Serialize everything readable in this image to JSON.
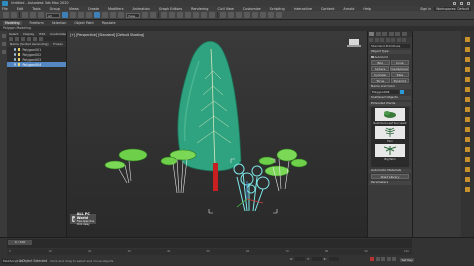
{
  "window": {
    "title": "Untitled - Autodesk 3ds Max 2020"
  },
  "menu": {
    "items": [
      "File",
      "Edit",
      "Tools",
      "Group",
      "Views",
      "Create",
      "Modifiers",
      "Animation",
      "Graph Editors",
      "Rendering",
      "Civil View",
      "Customize",
      "Scripting",
      "Interactive",
      "Content",
      "Arnold",
      "Help"
    ],
    "user": "Sign In",
    "workspace": "Workspaces: Default"
  },
  "toolbar": {
    "selection_filter": "All",
    "view_dropdown": "View"
  },
  "ribbon": {
    "tabs": [
      "Modeling",
      "Freeform",
      "Selection",
      "Object Paint",
      "Populate"
    ],
    "sub_label": "Polygon Modeling"
  },
  "explorer": {
    "tabs": [
      "Select",
      "Display",
      "Edit",
      "Customize"
    ],
    "column_header": "Name (Sorted Ascending)",
    "column_header_right": "Frozen",
    "rows": [
      {
        "label": "Polygon001",
        "selected": false
      },
      {
        "label": "Polygon002",
        "selected": false
      },
      {
        "label": "Polygon003",
        "selected": false
      },
      {
        "label": "Polygon004",
        "selected": true
      }
    ]
  },
  "viewport": {
    "label": "[+] [Perspective] [Standard] [Default Shading]",
    "watermark": {
      "title": "ALL PC World",
      "subtitle": "Free Apps One Click Away"
    }
  },
  "command_panel": {
    "category_dropdown": "Standard Primitives",
    "object_type_header": "Object Type",
    "autogrid_label": "AutoGrid",
    "buttons": [
      [
        "Box",
        "Cone"
      ],
      [
        "Sphere",
        "GeoSphere"
      ],
      [
        "Cylinder",
        "Tube"
      ],
      [
        "Torus",
        "Pyramid"
      ]
    ],
    "name_color_header": "Name and Color",
    "object_name": "Polygon004",
    "scattered_header": "Scattered Objects",
    "library_header": "Extended Plants",
    "thumbs": [
      {
        "label": "Rushmore Leaf Succulent"
      },
      {
        "label": "Fern"
      },
      {
        "label": "Big Palm"
      }
    ],
    "auto_header": "Automatic Materials",
    "auto_button": "Start Library",
    "parameters_header": "Parameters"
  },
  "timeline": {
    "frame": "0 / 100",
    "ticks": [
      "0",
      "10",
      "20",
      "30",
      "40",
      "50",
      "60",
      "70",
      "80",
      "90",
      "100"
    ]
  },
  "status": {
    "maxscript": "MAXScript Mi",
    "message": "1 Object Selected",
    "hint": "Click and drag to select and move objects",
    "x_label": "X:",
    "y_label": "Y:",
    "z_label": "Z:",
    "set_key": "Set Key"
  },
  "colors": {
    "selection_blue": "#5588c2",
    "plant_green": "#2fa37f",
    "selected_cyan": "#7ee8ea",
    "stem_red": "#c82020",
    "tool_orange": "#c8922a"
  }
}
